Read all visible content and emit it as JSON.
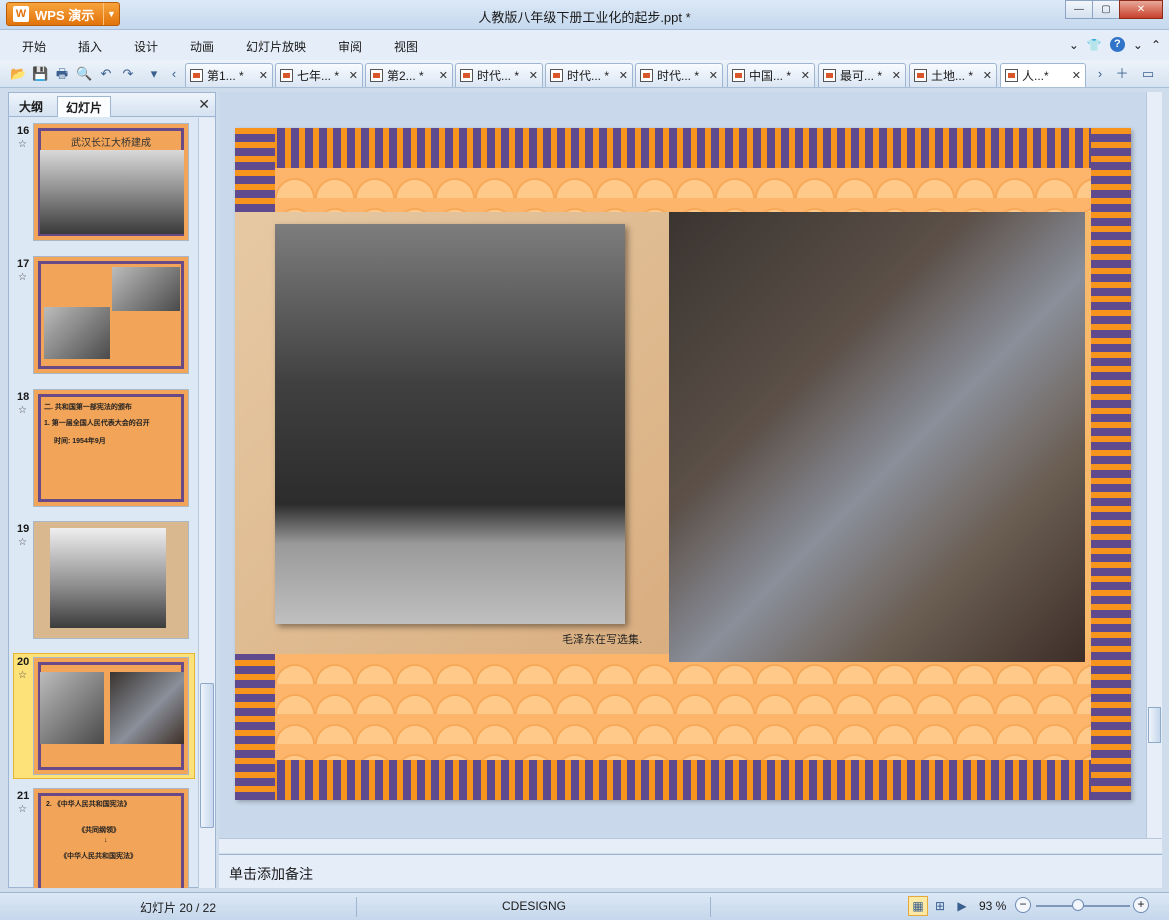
{
  "titlebar": {
    "app_name": "WPS 演示",
    "doc_title": "人教版八年级下册工业化的起步.ppt *"
  },
  "menu": [
    "开始",
    "插入",
    "设计",
    "动画",
    "幻灯片放映",
    "审阅",
    "视图"
  ],
  "tabs": [
    {
      "label": "第1... *"
    },
    {
      "label": "七年... *"
    },
    {
      "label": "第2... *"
    },
    {
      "label": "时代... *"
    },
    {
      "label": "时代... *"
    },
    {
      "label": "时代... *"
    },
    {
      "label": "中国... *"
    },
    {
      "label": "最可... *"
    },
    {
      "label": "土地... *"
    },
    {
      "label": "人...*"
    }
  ],
  "leftpane": {
    "tab_outline": "大纲",
    "tab_slides": "幻灯片",
    "slides": [
      {
        "num": "16",
        "title": "武汉长江大桥建成"
      },
      {
        "num": "17",
        "title": ""
      },
      {
        "num": "18",
        "line1": "二. 共和国第一部宪法的颁布",
        "line2": "1. 第一届全国人民代表大会的召开",
        "line3": "时间:     1954年9月"
      },
      {
        "num": "19",
        "title": ""
      },
      {
        "num": "20",
        "title": ""
      },
      {
        "num": "21",
        "line1": "2. 《中华人民共和国宪法》",
        "line2": "《共同纲领》",
        "line3": "《中华人民共和国宪法》"
      }
    ],
    "star": "☆",
    "selected_index": 4
  },
  "slide": {
    "caption": "毛泽东在写选集."
  },
  "notes": {
    "placeholder": "单击添加备注"
  },
  "status": {
    "slide_counter": "幻灯片 20 / 22",
    "theme": "CDESIGNG",
    "zoom": "93 %"
  }
}
